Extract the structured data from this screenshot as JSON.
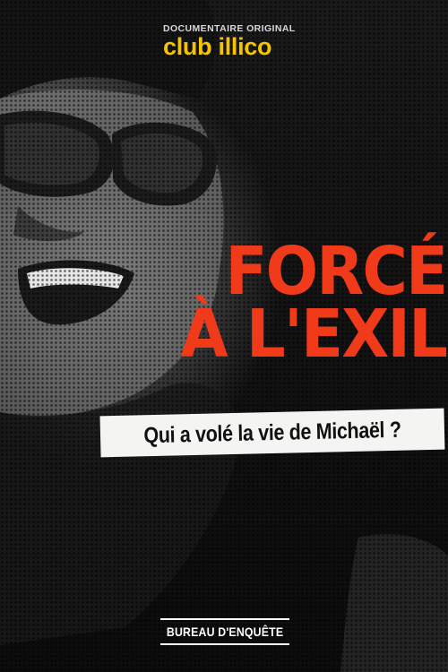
{
  "brand": {
    "label": "DOCUMENTAIRE ORIGINAL",
    "name": "club illico",
    "name_color": "#f4c400"
  },
  "title": {
    "line1": "FORCÉ",
    "line2": "À L'EXIL",
    "color": "#f03a1a"
  },
  "subtitle": "Qui a volé la vie de Michaël ?",
  "badge": "BUREAU D'ENQUÊTE"
}
